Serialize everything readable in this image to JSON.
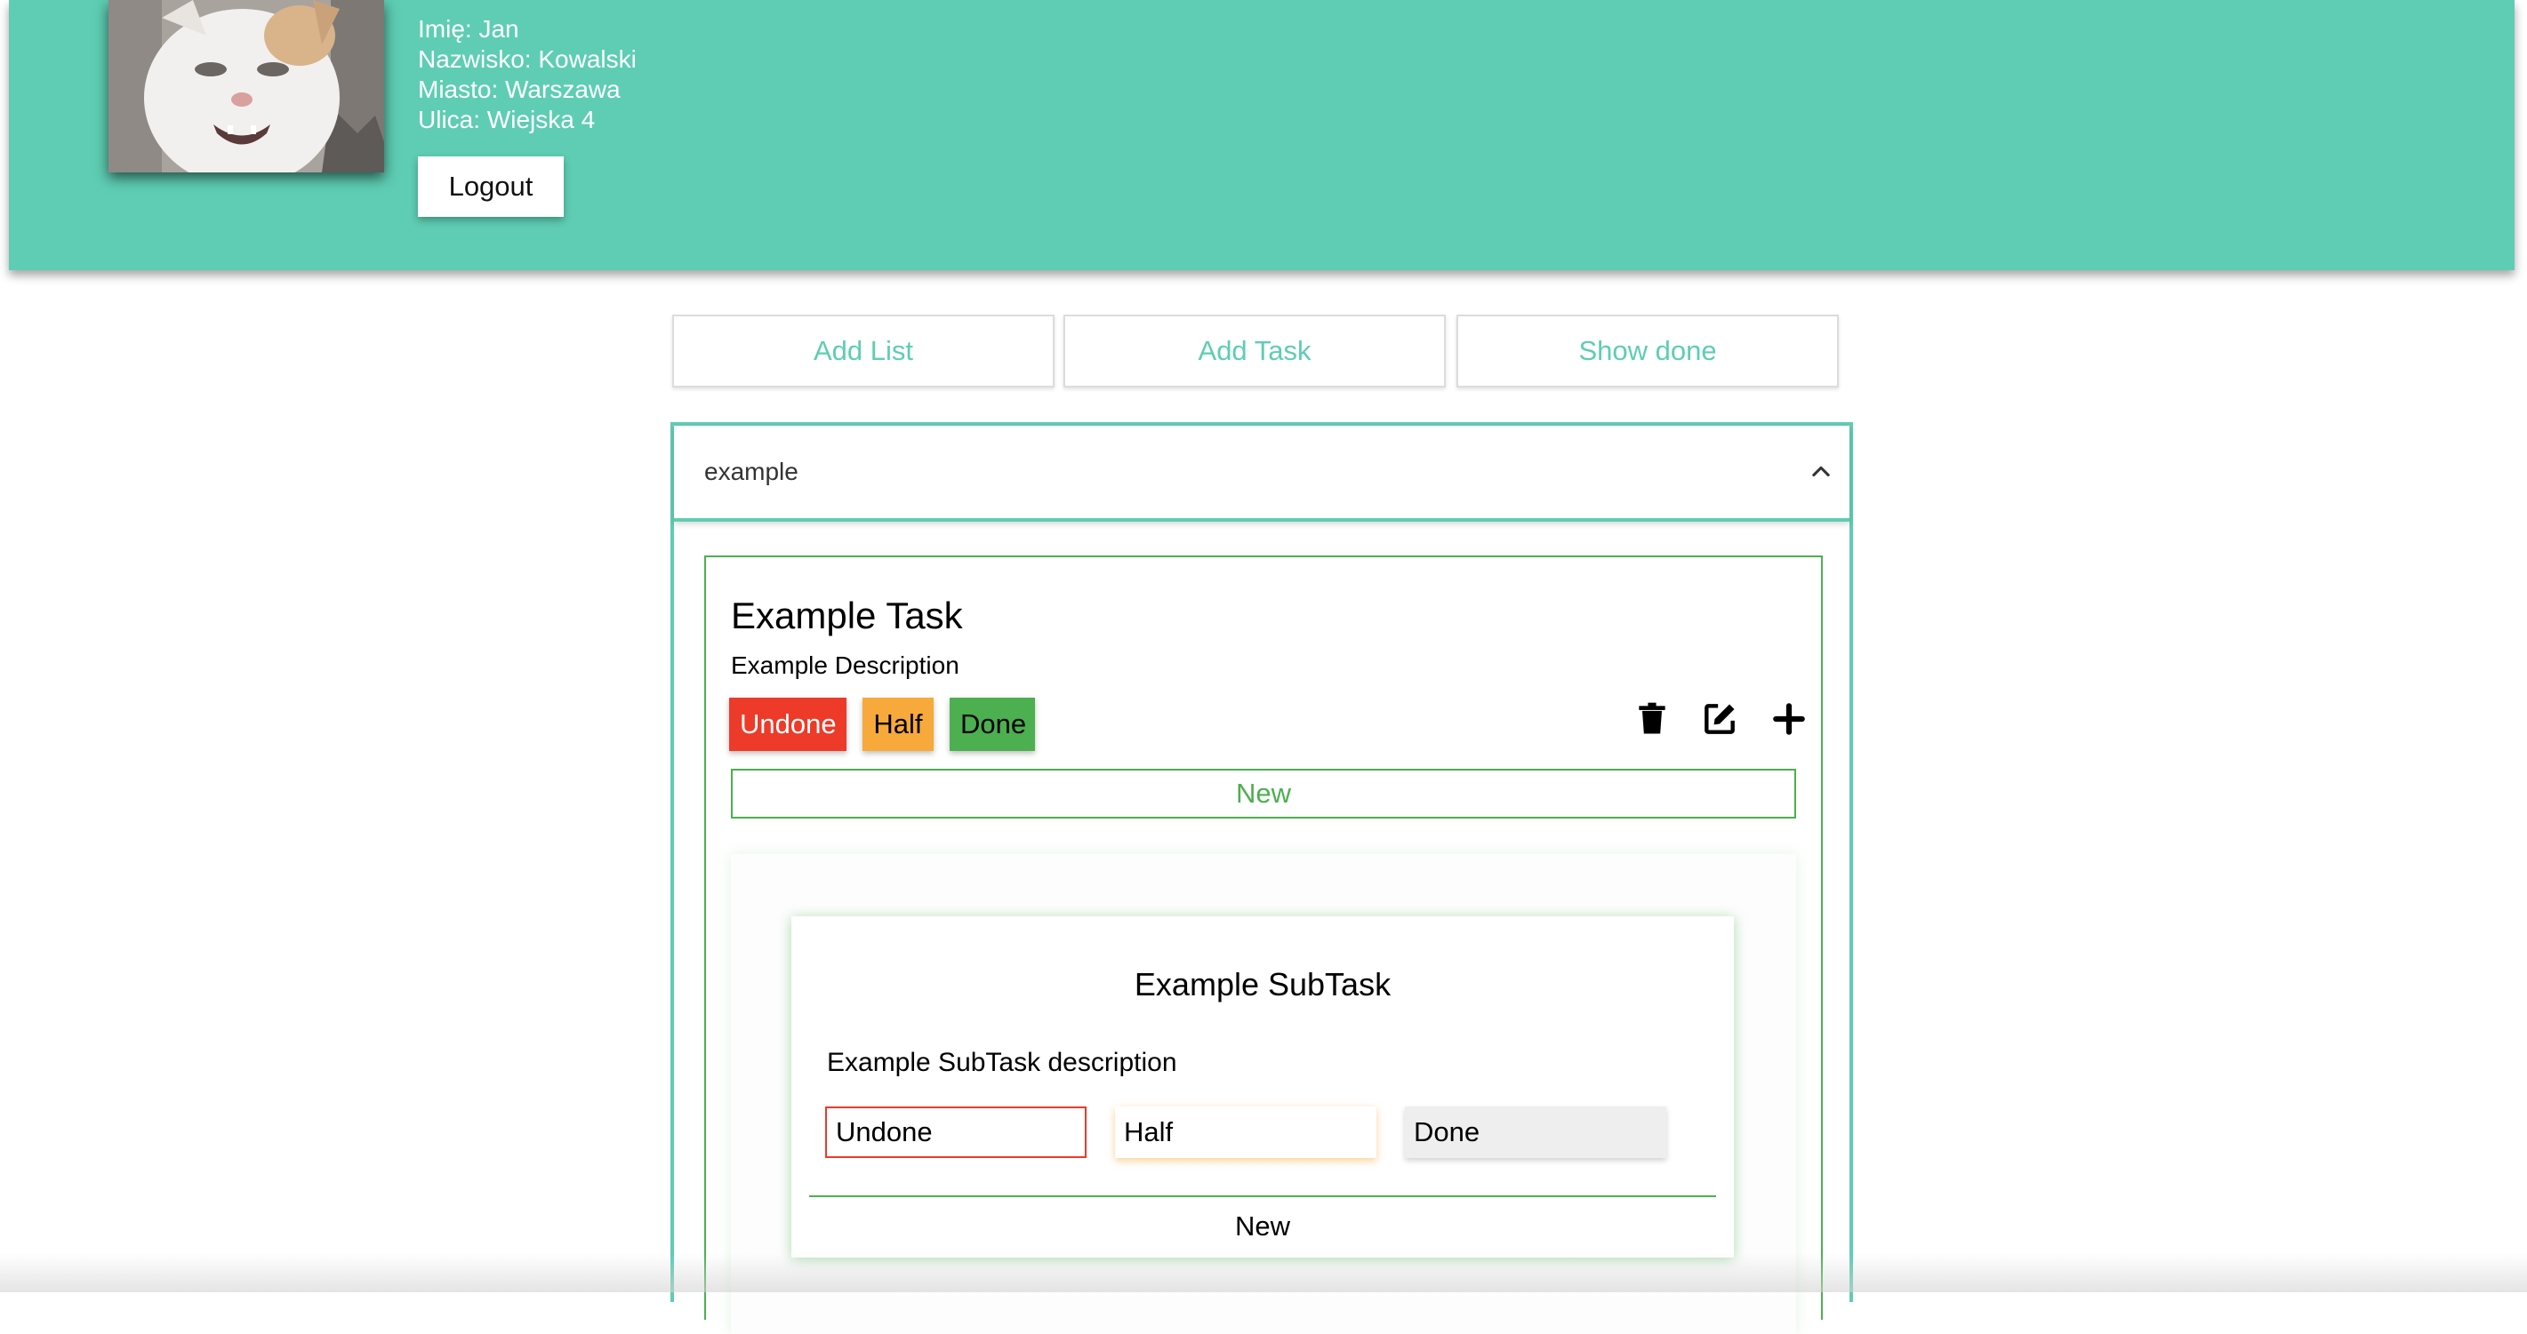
{
  "header": {
    "user": {
      "first_name": "Imię: Jan",
      "last_name": "Nazwisko: Kowalski",
      "city": "Miasto: Warszawa",
      "street": "Ulica: Wiejska 4"
    },
    "logout_label": "Logout"
  },
  "actions": {
    "add_list": "Add List",
    "add_task": "Add Task",
    "show_done": "Show done"
  },
  "list": {
    "title": "example",
    "task": {
      "title": "Example Task",
      "description": "Example Description",
      "statuses": [
        "Undone",
        "Half",
        "Done"
      ],
      "icons": [
        "trash-icon",
        "edit-icon",
        "plus-icon"
      ],
      "new_label": "New",
      "subtask": {
        "title": "Example SubTask",
        "description": "Example SubTask description",
        "statuses": [
          "Undone",
          "Half",
          "Done"
        ],
        "new_label": "New"
      }
    }
  },
  "colors": {
    "header_bg": "#5ecdb3",
    "accent": "#5ecdb3",
    "undone": "#ee3a29",
    "half": "#f7a93b",
    "done": "#4caf50"
  }
}
